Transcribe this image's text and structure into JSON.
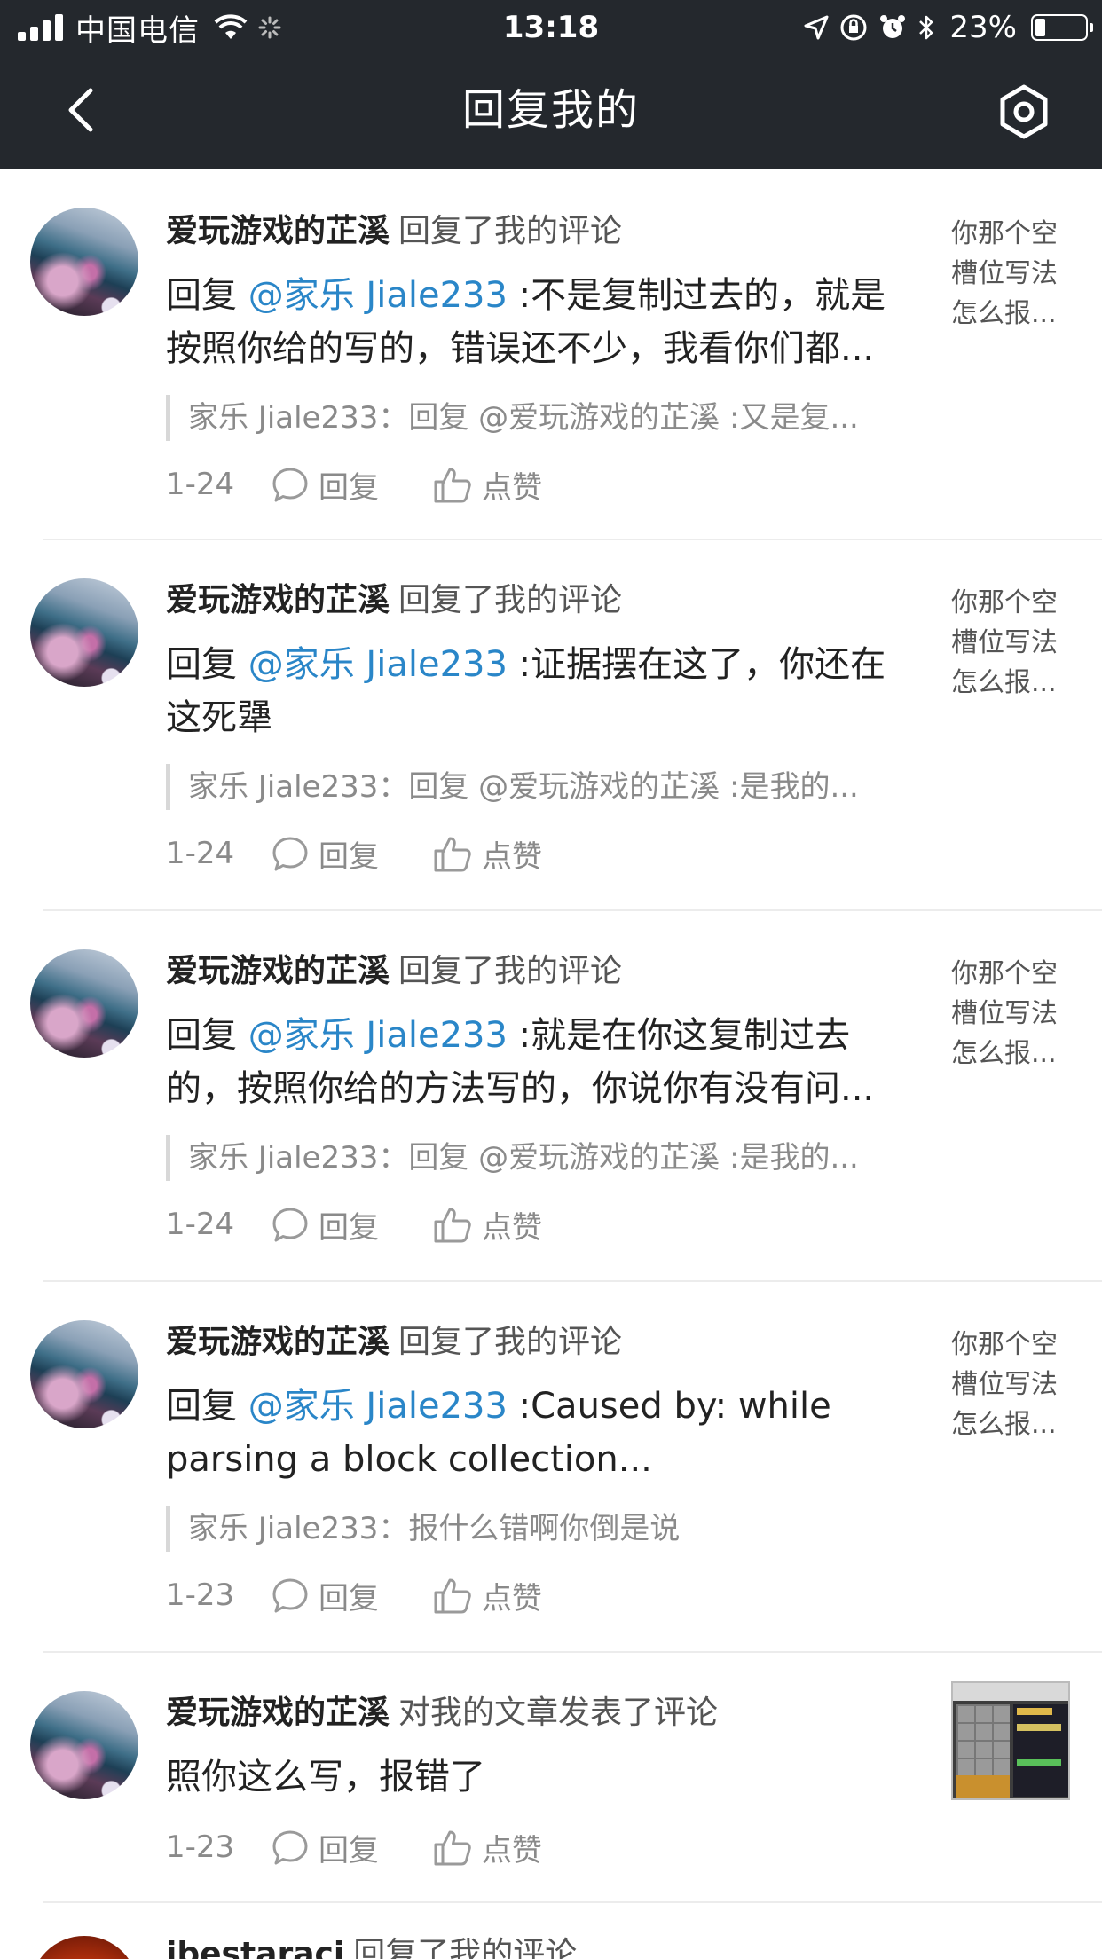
{
  "status_bar": {
    "carrier": "中国电信",
    "time": "13:18",
    "battery": "23%"
  },
  "header": {
    "title": "回复我的",
    "back_icon": "chevron-left-icon",
    "settings_icon": "hexagon-gear-icon"
  },
  "colors": {
    "header_bg": "#24282d",
    "mention": "#2a86c8",
    "muted": "#8a8a8a"
  },
  "items": [
    {
      "user": "爱玩游戏的芷溪",
      "action": "回复了我的评论",
      "reply_prefix": "回复 ",
      "mention": "@家乐 Jiale233",
      "content_line1": " :不是复制过去的，就是",
      "content_line2": "按照你给的写的，错误还不少，我看你们都...",
      "quote": "家乐 Jiale233：回复 @爱玩游戏的芷溪 :又是复...",
      "date": "1-24",
      "reply_label": "回复",
      "like_label": "点赞",
      "side": [
        "你那个空",
        "槽位写法",
        "怎么报..."
      ]
    },
    {
      "user": "爱玩游戏的芷溪",
      "action": "回复了我的评论",
      "reply_prefix": "回复 ",
      "mention": "@家乐 Jiale233",
      "content_line1": " :证据摆在这了，你还在",
      "content_line2": "这死犟",
      "quote": "家乐 Jiale233：回复 @爱玩游戏的芷溪 :是我的...",
      "date": "1-24",
      "reply_label": "回复",
      "like_label": "点赞",
      "side": [
        "你那个空",
        "槽位写法",
        "怎么报..."
      ]
    },
    {
      "user": "爱玩游戏的芷溪",
      "action": "回复了我的评论",
      "reply_prefix": "回复 ",
      "mention": "@家乐 Jiale233",
      "content_line1": " :就是在你这复制过去",
      "content_line2": "的，按照你给的方法写的，你说你有没有问...",
      "quote": "家乐 Jiale233：回复 @爱玩游戏的芷溪 :是我的...",
      "date": "1-24",
      "reply_label": "回复",
      "like_label": "点赞",
      "side": [
        "你那个空",
        "槽位写法",
        "怎么报..."
      ]
    },
    {
      "user": "爱玩游戏的芷溪",
      "action": "回复了我的评论",
      "reply_prefix": "回复 ",
      "mention": "@家乐 Jiale233",
      "content_line1": " :Caused by: while",
      "content_line2": "parsing a block collection...",
      "quote": "家乐 Jiale233：报什么错啊你倒是说",
      "date": "1-23",
      "reply_label": "回复",
      "like_label": "点赞",
      "side": [
        "你那个空",
        "槽位写法",
        "怎么报..."
      ]
    },
    {
      "user": "爱玩游戏的芷溪",
      "action": "对我的文章发表了评论",
      "content": "照你这么写，报错了",
      "date": "1-23",
      "reply_label": "回复",
      "like_label": "点赞"
    },
    {
      "user": "ibestaraci",
      "action": "回复了我的评论"
    }
  ]
}
